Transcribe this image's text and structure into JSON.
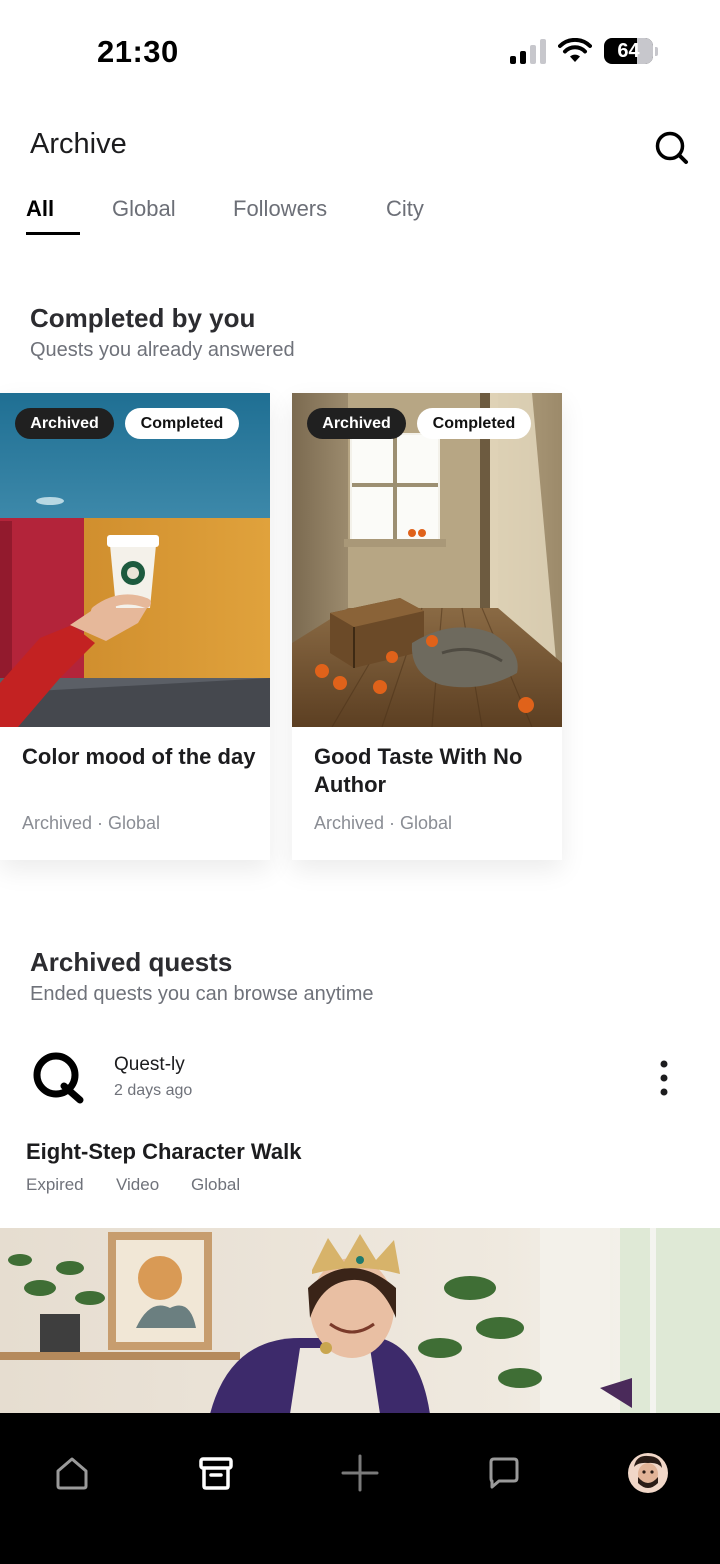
{
  "status_bar": {
    "time": "21:30",
    "battery": "64"
  },
  "header": {
    "title": "Archive"
  },
  "tabs": [
    {
      "label": "All",
      "active": true
    },
    {
      "label": "Global",
      "active": false
    },
    {
      "label": "Followers",
      "active": false
    },
    {
      "label": "City",
      "active": false
    }
  ],
  "completed_section": {
    "title": "Completed by you",
    "subtitle": "Quests you already answered",
    "cards": [
      {
        "badge_archived": "Archived",
        "badge_completed": "Completed",
        "title": "Color mood of the day",
        "meta": "Archived · Global"
      },
      {
        "badge_archived": "Archived",
        "badge_completed": "Completed",
        "title": "Good Taste With No Author",
        "meta": "Archived · Global"
      }
    ]
  },
  "archived_section": {
    "title": "Archived quests",
    "subtitle": "Ended quests you can browse anytime",
    "posts": [
      {
        "author": "Quest-ly",
        "time": "2 days ago",
        "title": "Eight-Step Character Walk",
        "tags": [
          "Expired",
          "Video",
          "Global"
        ]
      }
    ]
  },
  "bottom_nav": {
    "items": [
      {
        "icon": "home-icon"
      },
      {
        "icon": "archive-icon",
        "active": true
      },
      {
        "icon": "plus-icon"
      },
      {
        "icon": "chat-icon"
      },
      {
        "icon": "profile-avatar"
      }
    ]
  }
}
